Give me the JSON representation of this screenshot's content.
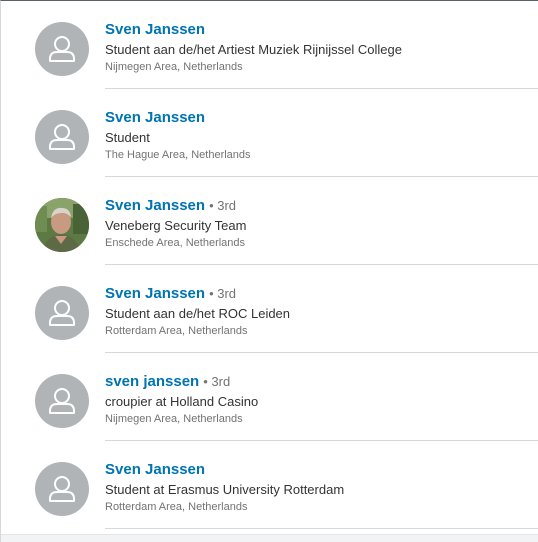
{
  "results": [
    {
      "name": "Sven Janssen",
      "degree": "",
      "headline": "Student aan de/het Artiest Muziek Rijnijssel College",
      "location": "Nijmegen Area, Netherlands",
      "avatar": "placeholder-person-icon"
    },
    {
      "name": "Sven Janssen",
      "degree": "",
      "headline": "Student",
      "location": "The Hague Area, Netherlands",
      "avatar": "placeholder-person-icon"
    },
    {
      "name": "Sven Janssen",
      "degree": "3rd",
      "headline": "Veneberg Security Team",
      "location": "Enschede Area, Netherlands",
      "avatar": "profile-photo"
    },
    {
      "name": "Sven Janssen",
      "degree": "3rd",
      "headline": "Student aan de/het ROC Leiden",
      "location": "Rotterdam Area, Netherlands",
      "avatar": "placeholder-person-icon"
    },
    {
      "name": "sven janssen",
      "degree": "3rd",
      "headline": "croupier at Holland Casino",
      "location": "Nijmegen Area, Netherlands",
      "avatar": "placeholder-person-icon"
    },
    {
      "name": "Sven Janssen",
      "degree": "",
      "headline": "Student at Erasmus University Rotterdam",
      "location": "Rotterdam Area, Netherlands",
      "avatar": "placeholder-person-icon"
    }
  ],
  "colors": {
    "name_link": "#0073b1",
    "avatar_placeholder": "#b0b4b7",
    "secondary_text": "#737373",
    "divider": "#d6d9dc"
  }
}
